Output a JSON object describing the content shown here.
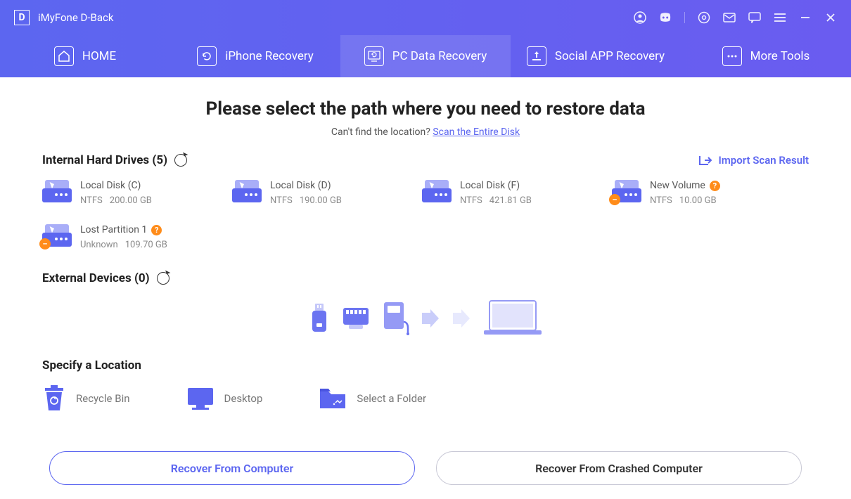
{
  "titlebar": {
    "logo": "D",
    "title": "iMyFone D-Back"
  },
  "tabs": [
    {
      "label": "HOME"
    },
    {
      "label": "iPhone Recovery"
    },
    {
      "label": "PC Data Recovery"
    },
    {
      "label": "Social APP Recovery"
    },
    {
      "label": "More Tools"
    }
  ],
  "headline": "Please select the path where you need to restore data",
  "subhead_prefix": "Can't find the location? ",
  "subhead_link": "Scan the Entire Disk",
  "import_link": "Import Scan Result",
  "sections": {
    "internal": "Internal Hard Drives (5)",
    "external": "External Devices (0)",
    "specify": "Specify a Location"
  },
  "drives": [
    {
      "name": "Local Disk (C)",
      "fs": "NTFS",
      "size": "200.00 GB",
      "warn": false,
      "help": false
    },
    {
      "name": "Local Disk (D)",
      "fs": "NTFS",
      "size": "190.00 GB",
      "warn": false,
      "help": false
    },
    {
      "name": "Local Disk (F)",
      "fs": "NTFS",
      "size": "421.81 GB",
      "warn": false,
      "help": false
    },
    {
      "name": "New Volume",
      "fs": "NTFS",
      "size": "10.00 GB",
      "warn": true,
      "help": true
    },
    {
      "name": "Lost Partition 1",
      "fs": "Unknown",
      "size": "109.70 GB",
      "warn": true,
      "help": true
    }
  ],
  "locations": [
    {
      "label": "Recycle Bin"
    },
    {
      "label": "Desktop"
    },
    {
      "label": "Select a Folder"
    }
  ],
  "footer": {
    "primary": "Recover From Computer",
    "secondary": "Recover From Crashed Computer"
  }
}
